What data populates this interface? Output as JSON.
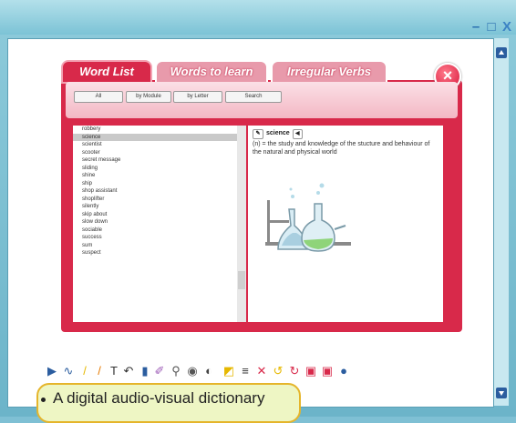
{
  "window": {
    "minimize": "–",
    "maximize": "□",
    "close": "X"
  },
  "tabs": [
    "Word List",
    "Words to learn",
    "Irregular Verbs"
  ],
  "close_button": "×",
  "filters": [
    "All",
    "by Module",
    "by Letter",
    "Search"
  ],
  "words": [
    "robbery",
    "science",
    "scientist",
    "scooter",
    "secret message",
    "sliding",
    "shine",
    "ship",
    "shop assistant",
    "shoplifter",
    "silently",
    "skip about",
    "slow down",
    "sociable",
    "success",
    "sum",
    "suspect"
  ],
  "selected_word": "science",
  "definition": {
    "word": "science",
    "text": "(n) = the study and knowledge of the stucture and behaviour of the natural and physical world"
  },
  "toolbar_icons": [
    "cursor-icon",
    "lasso-icon",
    "pen-yellow-icon",
    "pen-orange-icon",
    "text-icon",
    "curve-icon",
    "marker-blue-icon",
    "highlighter-icon",
    "magnifier-icon",
    "camera-icon",
    "spotlight-icon",
    "shade-icon",
    "lines-icon",
    "delete-icon",
    "undo-icon",
    "redo-icon",
    "book-icon",
    "book-alt-icon",
    "globe-icon"
  ],
  "caption": "A digital audio-visual dictionary",
  "colors": {
    "accent": "#d8294a",
    "frame": "#7fc0d4",
    "caption_border": "#e5b52b"
  }
}
